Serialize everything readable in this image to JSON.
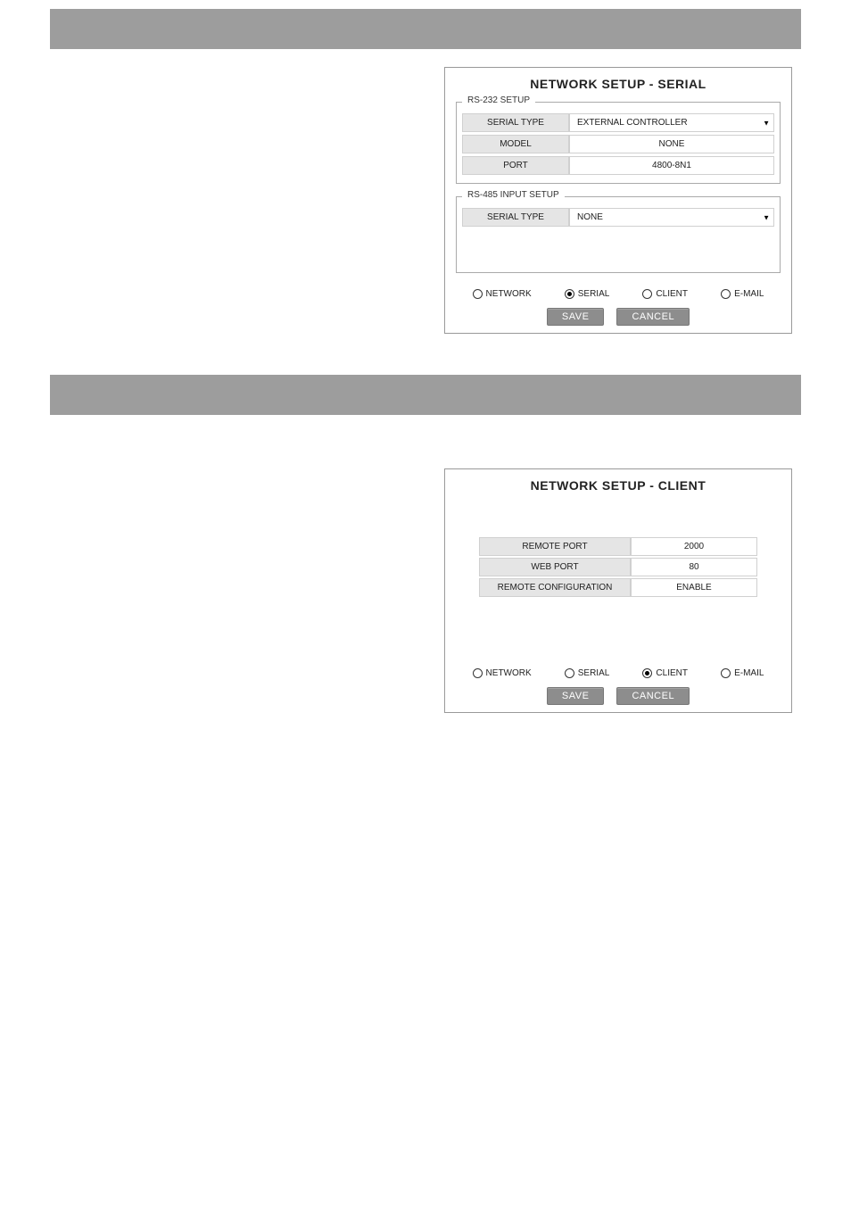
{
  "serial_dialog": {
    "title": "NETWORK SETUP - SERIAL",
    "rs232": {
      "legend": "RS-232 SETUP",
      "serial_type_label": "SERIAL TYPE",
      "serial_type_value": "EXTERNAL CONTROLLER",
      "model_label": "MODEL",
      "model_value": "NONE",
      "port_label": "PORT",
      "port_value": "4800-8N1"
    },
    "rs485": {
      "legend": "RS-485 INPUT SETUP",
      "serial_type_label": "SERIAL TYPE",
      "serial_type_value": "NONE"
    },
    "tabs": {
      "network": "NETWORK",
      "serial": "SERIAL",
      "client": "CLIENT",
      "email": "E-MAIL"
    },
    "save": "SAVE",
    "cancel": "CANCEL"
  },
  "client_dialog": {
    "title": "NETWORK SETUP - CLIENT",
    "remote_port_label": "REMOTE PORT",
    "remote_port_value": "2000",
    "web_port_label": "WEB PORT",
    "web_port_value": "80",
    "remote_conf_label": "REMOTE CONFIGURATION",
    "remote_conf_value": "ENABLE",
    "tabs": {
      "network": "NETWORK",
      "serial": "SERIAL",
      "client": "CLIENT",
      "email": "E-MAIL"
    },
    "save": "SAVE",
    "cancel": "CANCEL"
  }
}
